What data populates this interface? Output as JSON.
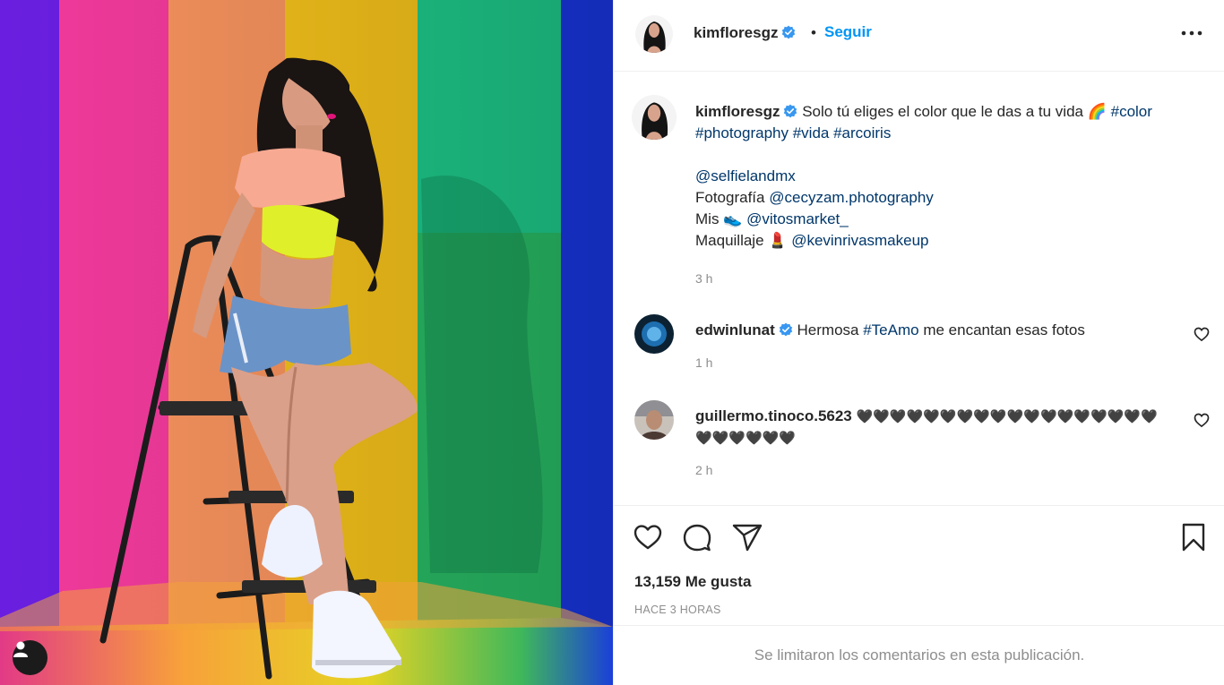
{
  "post": {
    "author": "kimfloresgz",
    "follow_label": "Seguir",
    "separator": "•",
    "photo_alt_icon": "user-tag-icon"
  },
  "caption": {
    "username": "kimfloresgz",
    "text_1": "Solo tú eliges el color que le das a tu vida",
    "emoji_1": "🌈",
    "hashtags_line1": "#color",
    "hashtag_2": "#photography",
    "hashtag_3": "#vida",
    "hashtag_4": "#arcoiris",
    "mention_1": "@selfielandmx",
    "photo_label": "Fotografía",
    "mention_2": "@cecyzam.photography",
    "mis_label": "Mis",
    "shoe_emoji": "👟",
    "mention_3": "@vitosmarket_",
    "makeup_label": "Maquillaje",
    "lipstick_emoji": "💄",
    "mention_4": "@kevinrivasmakeup",
    "time": "3 h"
  },
  "comments": [
    {
      "username": "edwinlunat",
      "verified": true,
      "text_before": "Hermosa",
      "hashtag": "#TeAmo",
      "text_after": "me encantan esas fotos",
      "time": "1 h"
    },
    {
      "username": "guillermo.tinoco.5623",
      "verified": false,
      "hearts_line1": "🖤🖤🖤🖤🖤🖤🖤🖤🖤🖤🖤🖤🖤🖤🖤🖤🖤🖤",
      "hearts_line2": "🖤🖤🖤🖤🖤🖤",
      "time": "2 h"
    }
  ],
  "actions": {
    "likes": "13,159 Me gusta",
    "posted": "HACE 3 HORAS"
  },
  "footer": {
    "notice": "Se limitaron los comentarios en esta publicación."
  },
  "colors": {
    "accent": "#0095f6",
    "link": "#00376b",
    "muted": "#8e8e8e",
    "verified": "#3897f0"
  }
}
